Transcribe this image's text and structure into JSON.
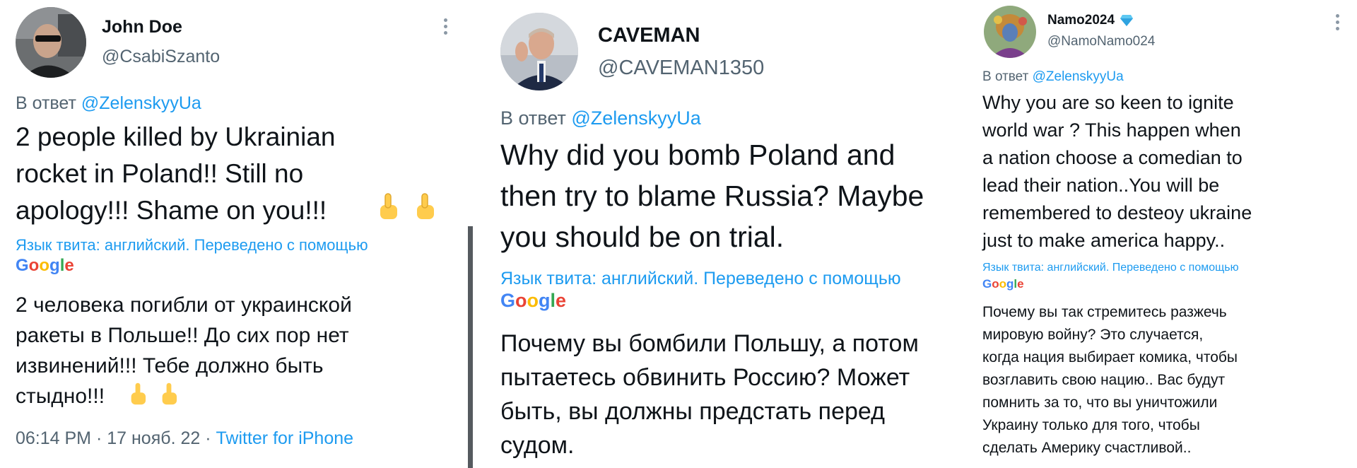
{
  "tweet1": {
    "display_name": "John Doe",
    "handle": "@CsabiSzanto",
    "reply_prefix": "В ответ",
    "reply_mention": "@ZelenskyyUa",
    "text": "2 people killed by Ukrainian\nrocket in Poland!! Still no\napology!!! Shame on you!!!",
    "emoji": "point-up-emoji",
    "lang_note": "Язык твита: английский. Переведено с помощью",
    "translator": "Google",
    "translated_text": "2 человека погибли от украинской\nракеты в Польше!! До сих пор нет\nизвинений!!! Тебе должно быть\nстыдно!!!",
    "time": "06:14 PM",
    "date": "17 нояб. 22",
    "source": "Twitter for iPhone",
    "sep": "·"
  },
  "tweet2": {
    "display_name": "CAVEMAN",
    "handle": "@CAVEMAN1350",
    "reply_prefix": "В ответ",
    "reply_mention": "@ZelenskyyUa",
    "text": "Why did you bomb Poland and\nthen try to blame Russia? Maybe\nyou should be on trial.",
    "lang_note": "Язык твита: английский. Переведено с помощью",
    "translator": "Google",
    "translated_text": "Почему вы бомбили Польшу, а потом\nпытаетесь обвинить Россию? Может\nбыть, вы должны предстать перед\nсудом."
  },
  "tweet3": {
    "display_name": "Namo2024",
    "handle": "@NamoNamo024",
    "verified_icon": "diamond-icon",
    "reply_prefix": "В ответ",
    "reply_mention": "@ZelenskyyUa",
    "text": "Why you are so keen to ignite\nworld war ? This happen when\na nation choose a comedian to\nlead their nation..You will be\nremembered to desteoy ukraine\njust to make america happy..",
    "lang_note": "Язык твита: английский. Переведено с помощью",
    "translator": "Google",
    "translated_text": "Почему вы так стремитесь разжечь\nмировую войну? Это случается,\nкогда нация выбирает комика, чтобы\nвозглавить свою нацию.. Вас будут\nпомнить за то, что вы уничтожили\nУкраину только для того, чтобы\nсделать Америку счастливой.."
  },
  "colors": {
    "link": "#1d9bf0",
    "secondary_text": "#536471",
    "primary_text": "#0f1419"
  }
}
